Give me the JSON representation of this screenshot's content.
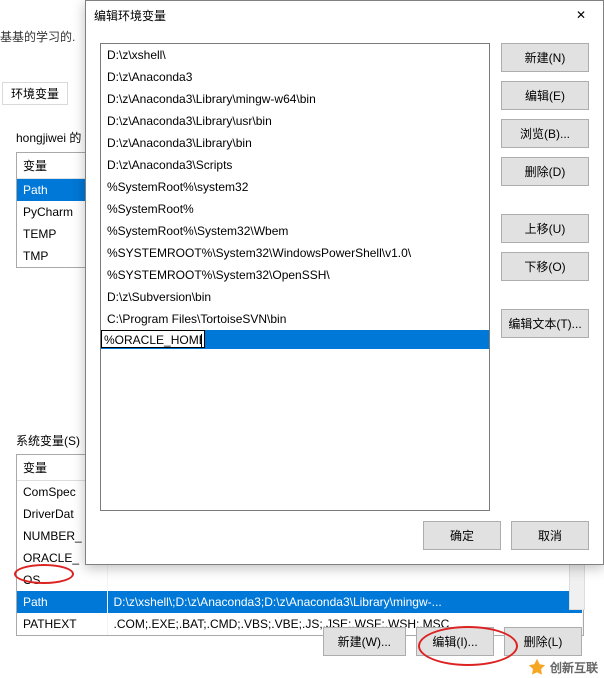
{
  "background": {
    "partial_title": "基基的学习的.",
    "tab_label": "环境变量",
    "user_section_title": "hongjiwei 的",
    "user_vars_header": "变量",
    "user_vars": [
      "Path",
      "PyCharm",
      "TEMP",
      "TMP"
    ],
    "sys_section_title": "系统变量(S)",
    "sys_headers": [
      "变量",
      ""
    ],
    "sys_vars": [
      {
        "name": "ComSpec",
        "value": ""
      },
      {
        "name": "DriverDat",
        "value": ""
      },
      {
        "name": "NUMBER_",
        "value": ""
      },
      {
        "name": "ORACLE_",
        "value": ""
      },
      {
        "name": "OS",
        "value": ""
      },
      {
        "name": "Path",
        "value": "D:\\z\\xshell\\;D:\\z\\Anaconda3;D:\\z\\Anaconda3\\Library\\mingw-..."
      },
      {
        "name": "PATHEXT",
        "value": ".COM;.EXE;.BAT;.CMD;.VBS;.VBE;.JS;.JSE;.WSF;.WSH;.MSC"
      }
    ],
    "sys_selected_index": 5,
    "buttons": {
      "new": "新建(W)...",
      "edit": "编辑(I)...",
      "delete": "删除(L)"
    }
  },
  "dialog": {
    "title": "编辑环境变量",
    "paths": [
      "D:\\z\\xshell\\",
      "D:\\z\\Anaconda3",
      "D:\\z\\Anaconda3\\Library\\mingw-w64\\bin",
      "D:\\z\\Anaconda3\\Library\\usr\\bin",
      "D:\\z\\Anaconda3\\Library\\bin",
      "D:\\z\\Anaconda3\\Scripts",
      "%SystemRoot%\\system32",
      "%SystemRoot%",
      "%SystemRoot%\\System32\\Wbem",
      "%SYSTEMROOT%\\System32\\WindowsPowerShell\\v1.0\\",
      "%SYSTEMROOT%\\System32\\OpenSSH\\",
      "D:\\z\\Subversion\\bin",
      "C:\\Program Files\\TortoiseSVN\\bin"
    ],
    "editing_value": "%ORACLE_HOME%",
    "side_buttons": {
      "new": "新建(N)",
      "edit": "编辑(E)",
      "browse": "浏览(B)...",
      "delete": "删除(D)",
      "up": "上移(U)",
      "down": "下移(O)",
      "edit_text": "编辑文本(T)..."
    },
    "footer": {
      "ok": "确定",
      "cancel": "取消"
    }
  },
  "logo_text": "创新互联"
}
